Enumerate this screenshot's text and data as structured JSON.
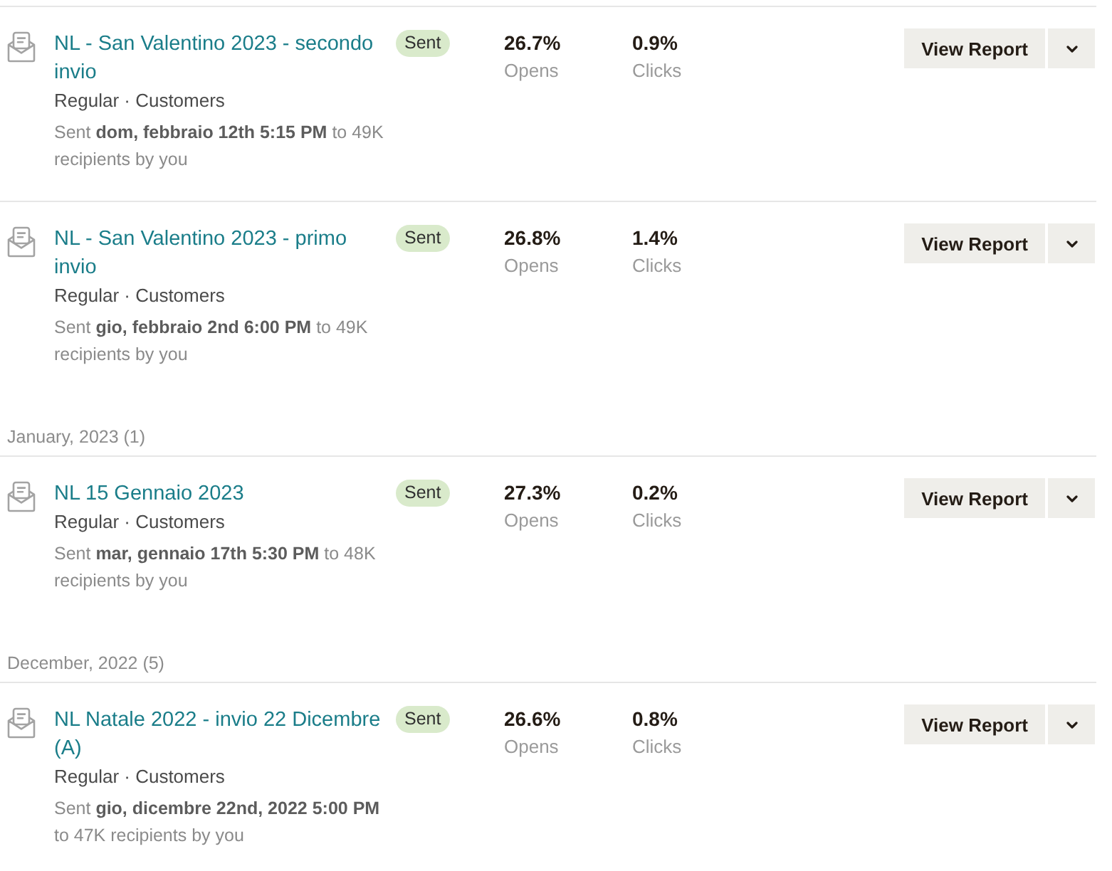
{
  "groups": [
    {
      "campaigns": [
        {
          "title": "NL - San Valentino 2023 - secondo invio",
          "status": "Sent",
          "meta": "Regular · Customers",
          "sent_line": "Sent **dom, febbraio 12th 5:15 PM** to 49K recipients by you",
          "stats": [
            {
              "value": "26.7%",
              "label": "Opens"
            },
            {
              "value": "0.9%",
              "label": "Clicks"
            }
          ],
          "action": "View Report"
        },
        {
          "title": "NL - San Valentino 2023 - primo invio",
          "status": "Sent",
          "meta": "Regular · Customers",
          "sent_line": "Sent **gio, febbraio 2nd 6:00 PM** to 49K recipients by you",
          "stats": [
            {
              "value": "26.8%",
              "label": "Opens"
            },
            {
              "value": "1.4%",
              "label": "Clicks"
            }
          ],
          "action": "View Report"
        }
      ]
    },
    {
      "heading": "January, 2023 (1)",
      "campaigns": [
        {
          "title": "NL 15 Gennaio 2023",
          "status": "Sent",
          "meta": "Regular · Customers",
          "sent_line": "Sent **mar, gennaio 17th 5:30 PM** to 48K recipients by you",
          "stats": [
            {
              "value": "27.3%",
              "label": "Opens"
            },
            {
              "value": "0.2%",
              "label": "Clicks"
            }
          ],
          "action": "View Report"
        }
      ]
    },
    {
      "heading": "December, 2022 (5)",
      "campaigns": [
        {
          "title": "NL Natale 2022 - invio 22 Dicembre (A)",
          "status": "Sent",
          "meta": "Regular · Customers",
          "sent_line": "Sent **gio, dicembre 22nd, 2022 5:00 PM** to 47K recipients by you",
          "stats": [
            {
              "value": "26.6%",
              "label": "Opens"
            },
            {
              "value": "0.8%",
              "label": "Clicks"
            }
          ],
          "action": "View Report"
        }
      ]
    }
  ]
}
